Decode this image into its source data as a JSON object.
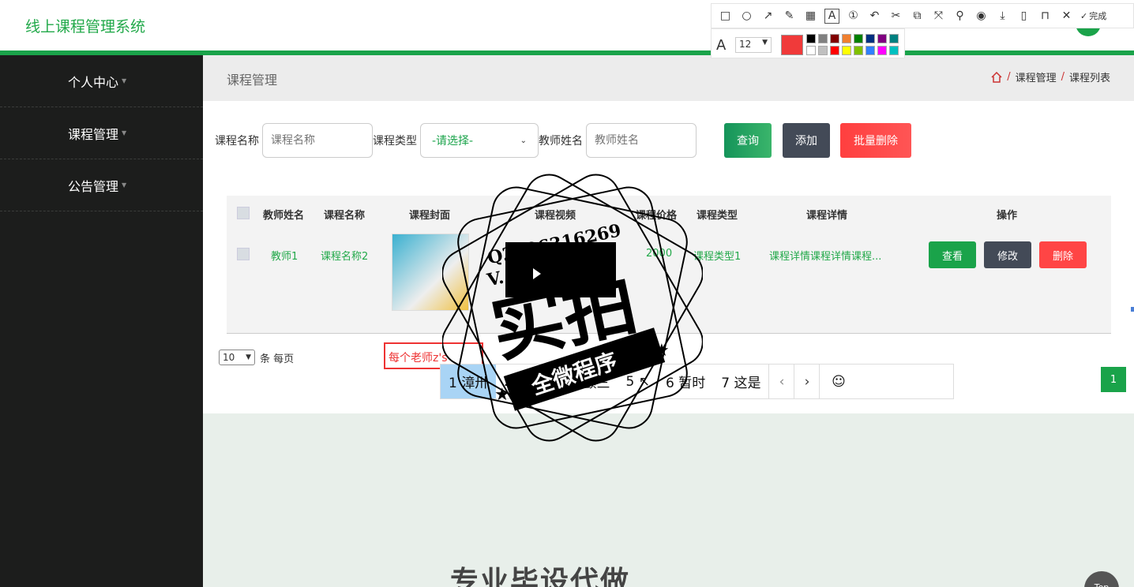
{
  "app": {
    "title": "线上课程管理系统"
  },
  "sidebar": {
    "items": [
      {
        "label": "个人中心"
      },
      {
        "label": "课程管理"
      },
      {
        "label": "公告管理"
      }
    ]
  },
  "page": {
    "title": "课程管理",
    "breadcrumb": [
      "课程管理",
      "课程列表"
    ]
  },
  "search": {
    "course_name_label": "课程名称",
    "course_name_placeholder": "课程名称",
    "course_type_label": "课程类型",
    "course_type_value": "-请选择-",
    "teacher_label": "教师姓名",
    "teacher_placeholder": "教师姓名",
    "query_label": "查询",
    "add_label": "添加",
    "batch_delete_label": "批量删除"
  },
  "table": {
    "columns": [
      "教师姓名",
      "课程名称",
      "课程封面",
      "课程视频",
      "课程价格",
      "课程类型",
      "课程详情",
      "操作"
    ],
    "rows": [
      {
        "teacher": "教师1",
        "name": "课程名称2",
        "price": "2000",
        "type": "课程类型1",
        "detail": "课程详情课程详情课程...",
        "view": "查看",
        "edit": "修改",
        "delete": "删除"
      }
    ]
  },
  "pager": {
    "page_size": "10",
    "per_page_label": "条 每页",
    "current_page": "1"
  },
  "ime": {
    "input": "每个老师z's",
    "candidates": [
      "1 漳卅",
      "2",
      "3 求",
      "4 颤三",
      "5 ↖",
      "6 暂时",
      "7 这是"
    ]
  },
  "tool": {
    "font_size": "12",
    "done_label": "完成",
    "current_color": "#f03a3a",
    "palette": [
      "#000000",
      "#808080",
      "#800000",
      "#f08030",
      "#008000",
      "#003080",
      "#800080",
      "#008080",
      "#ffffff",
      "#c0c0c0",
      "#ff0000",
      "#ffff00",
      "#80c000",
      "#3080ff",
      "#ff00ff",
      "#00c0c0"
    ]
  },
  "watermark": {
    "line1": "Q2196316269",
    "line2": "V...6499",
    "big": "实拍",
    "banner": "全微程序"
  },
  "bottom": {
    "text": "专业毕设代做",
    "top_label": "Top"
  },
  "colors": {
    "accent": "#1aa34a",
    "danger": "#ff4545",
    "dark": "#434a57",
    "sidebar": "#1c1d1c"
  }
}
